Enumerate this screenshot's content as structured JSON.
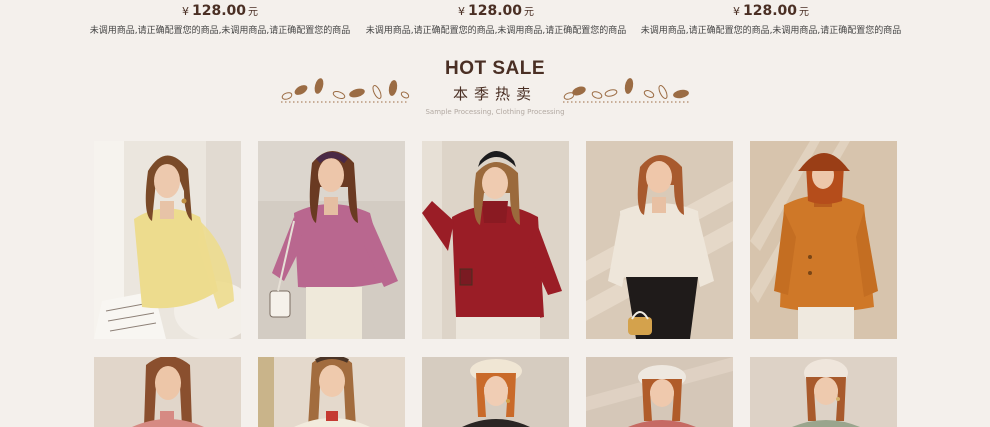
{
  "price_row": [
    {
      "currency": "¥",
      "price": "128.00",
      "unit": "元",
      "description": "未调用商品,请正确配置您的商品,未调用商品,请正确配置您的商品"
    },
    {
      "currency": "¥",
      "price": "128.00",
      "unit": "元",
      "description": "未调用商品,请正确配置您的商品,未调用商品,请正确配置您的商品"
    },
    {
      "currency": "¥",
      "price": "128.00",
      "unit": "元",
      "description": "未调用商品,请正确配置您的商品,未调用商品,请正确配置您的商品"
    }
  ],
  "hot_sale": {
    "title": "HOT SALE",
    "subtitle": "本季热卖",
    "caption": "Sample Processing, Clothing Processing"
  },
  "colors": {
    "background": "#f4f0ec",
    "accent_brown": "#4a2f24",
    "leaf": "#9b6c44"
  },
  "products_row1": [
    {
      "sweater_color": "#eddc8e",
      "backdrop": "#e7e0d8",
      "icon": "yellow-sweater-photo"
    },
    {
      "sweater_color": "#b9678f",
      "backdrop": "#d4ccc2",
      "icon": "pink-sweater-photo"
    },
    {
      "sweater_color": "#9a1d26",
      "backdrop": "#ddd4c8",
      "icon": "red-turtleneck-photo"
    },
    {
      "sweater_color": "#eee6da",
      "backdrop": "#d9cab8",
      "icon": "cream-sweater-photo"
    },
    {
      "sweater_color": "#cf7828",
      "backdrop": "#d7c4ad",
      "icon": "orange-coat-photo"
    }
  ],
  "products_row2": [
    {
      "sweater_color": "#d68a83",
      "backdrop": "#e1d6ca",
      "icon": "pink-knit-photo"
    },
    {
      "sweater_color": "#f2ebdd",
      "backdrop": "#e4d9cc",
      "icon": "cream-knit-photo"
    },
    {
      "sweater_color": "#2a2624",
      "backdrop": "#d6ccc0",
      "icon": "black-knit-photo"
    },
    {
      "sweater_color": "#c66a63",
      "backdrop": "#d5c7b8",
      "icon": "rose-knit-photo"
    },
    {
      "sweater_color": "#9aa58d",
      "backdrop": "#ddd2c6",
      "icon": "sage-knit-photo"
    }
  ]
}
